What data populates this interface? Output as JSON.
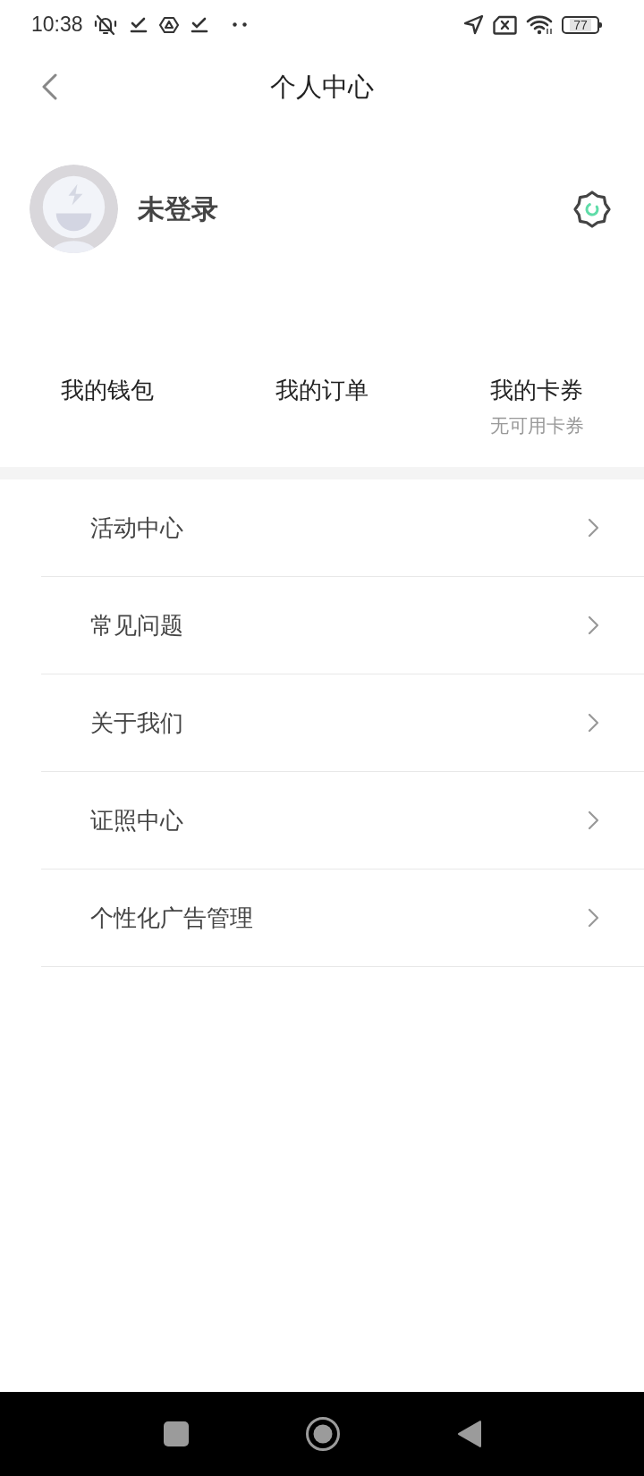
{
  "status_bar": {
    "time": "10:38",
    "battery": "77"
  },
  "header": {
    "title": "个人中心"
  },
  "profile": {
    "name": "未登录"
  },
  "shortcuts": [
    {
      "label": "我的钱包"
    },
    {
      "label": "我的订单"
    },
    {
      "label": "我的卡券",
      "subtitle": "无可用卡券"
    }
  ],
  "menu": [
    {
      "label": "活动中心"
    },
    {
      "label": "常见问题"
    },
    {
      "label": "关于我们"
    },
    {
      "label": "证照中心"
    },
    {
      "label": "个性化广告管理"
    }
  ]
}
